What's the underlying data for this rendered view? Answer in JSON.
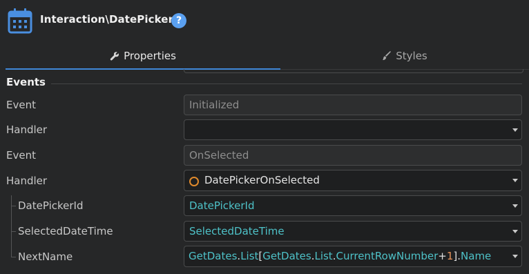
{
  "header": {
    "title": "Interaction\\DatePicker",
    "app_icon": "calendar-icon",
    "help_label": "?"
  },
  "tabs": [
    {
      "label": "Properties",
      "icon": "wrench-icon",
      "active": true
    },
    {
      "label": "Styles",
      "icon": "brush-icon",
      "active": false
    }
  ],
  "section": {
    "title": "Events"
  },
  "rows": {
    "event1": {
      "label": "Event",
      "value": "Initialized"
    },
    "handler1": {
      "label": "Handler",
      "value": ""
    },
    "event2": {
      "label": "Event",
      "value": "OnSelected"
    },
    "handler2": {
      "label": "Handler",
      "value": "DatePickerOnSelected"
    },
    "param1": {
      "label": "DatePickerId",
      "value": "DatePickerId"
    },
    "param2": {
      "label": "SelectedDateTime",
      "value": "SelectedDateTime"
    },
    "param3": {
      "label": "NextName",
      "expr": {
        "t1": "GetDates",
        "p1": ".",
        "t2": "List",
        "p2": "[",
        "t3": "GetDates",
        "p3": ".",
        "t4": "List",
        "p4": ".",
        "t5": "CurrentRowNumber",
        "p5": "+",
        "n1": "1",
        "p6": "].",
        "t6": "Name"
      }
    }
  },
  "colors": {
    "background": "#262728",
    "accent": "#3f88d8",
    "help_badge": "#5aa0f0",
    "variable_text": "#4ec2c8",
    "handler_circle": "#e08a2c",
    "number_literal": "#e8925a"
  }
}
